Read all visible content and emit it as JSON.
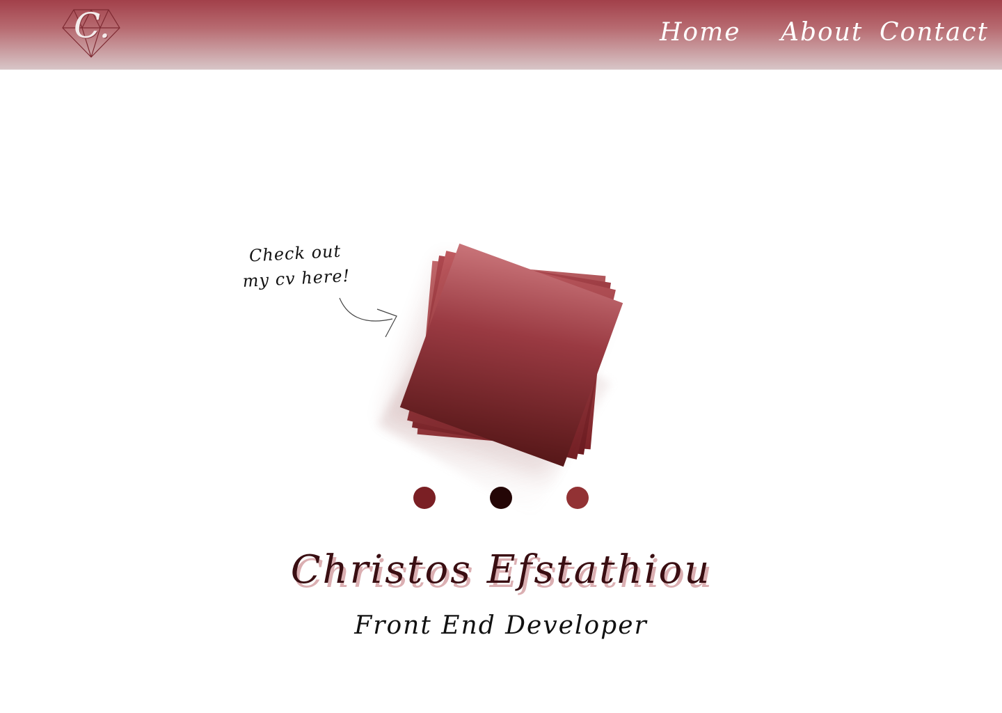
{
  "header": {
    "logo_letter": "C.",
    "nav": {
      "home": "Home",
      "about": "About",
      "contact": "Contact"
    }
  },
  "hero": {
    "cv_note": {
      "line1": "Check out",
      "line2": "my cv here!"
    },
    "carousel_dots": [
      {
        "color": "#7a1f24"
      },
      {
        "color": "#240606"
      },
      {
        "color": "#923234"
      }
    ],
    "name": "Christos Efstathiou",
    "role": "Front End Developer"
  },
  "colors": {
    "header_top": "#a2404a",
    "accent": "#7a1f24",
    "name_text": "#3a0e12"
  }
}
